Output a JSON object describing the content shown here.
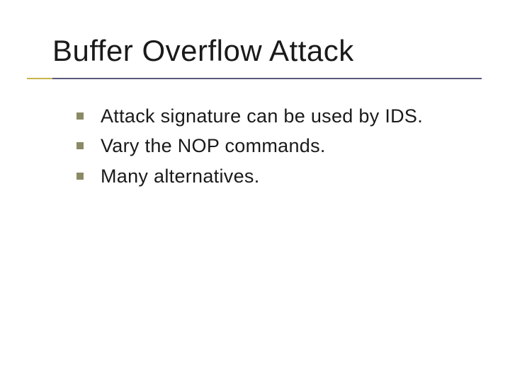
{
  "slide": {
    "title": "Buffer Overflow Attack",
    "bullets": [
      "Attack signature can be used by IDS.",
      "Vary the NOP commands.",
      "Many alternatives."
    ]
  }
}
